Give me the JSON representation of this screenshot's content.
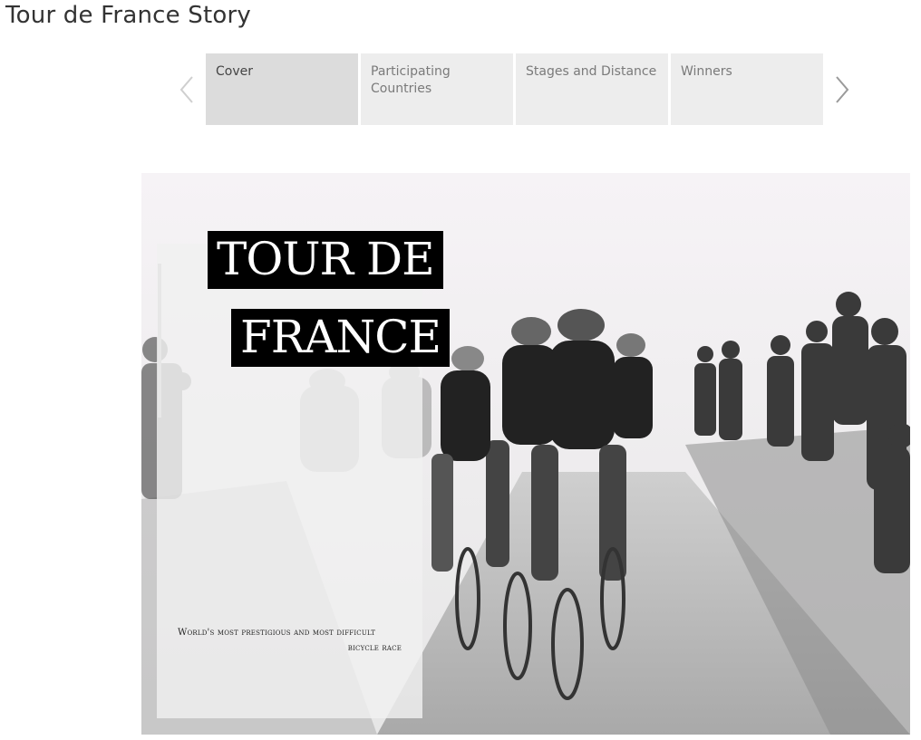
{
  "page": {
    "title": "Tour de France Story"
  },
  "navigation": {
    "prev_icon": "chevron-left-icon",
    "next_icon": "chevron-right-icon"
  },
  "story_points": [
    {
      "label": "Cover",
      "active": true
    },
    {
      "label": "Participating Countries",
      "active": false
    },
    {
      "label": "Stages and Distance",
      "active": false
    },
    {
      "label": "Winners",
      "active": false
    }
  ],
  "cover": {
    "title_line1": "TOUR DE",
    "title_line2": "FRANCE",
    "subtitle_line1": "World's most prestigious and most difficult",
    "subtitle_line2": "bicycle race"
  },
  "colors": {
    "active_tab": "#dcdcdc",
    "inactive_tab": "#ededed",
    "title_box": "#000000"
  }
}
